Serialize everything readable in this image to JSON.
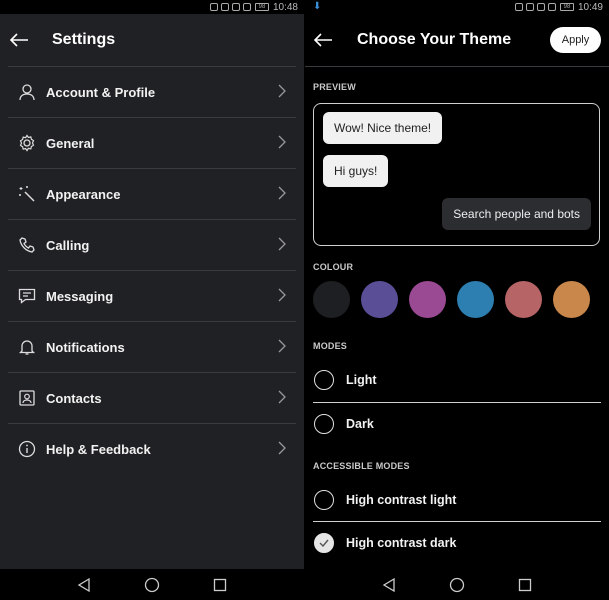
{
  "left": {
    "status_time": "10:48",
    "battery": "98",
    "title": "Settings",
    "items": [
      {
        "label": "Account & Profile",
        "icon": "person-icon"
      },
      {
        "label": "General",
        "icon": "gear-icon"
      },
      {
        "label": "Appearance",
        "icon": "magic-wand-icon"
      },
      {
        "label": "Calling",
        "icon": "phone-icon"
      },
      {
        "label": "Messaging",
        "icon": "chat-icon"
      },
      {
        "label": "Notifications",
        "icon": "bell-icon"
      },
      {
        "label": "Contacts",
        "icon": "contact-card-icon"
      },
      {
        "label": "Help & Feedback",
        "icon": "info-icon"
      }
    ]
  },
  "right": {
    "status_time": "10:49",
    "battery": "98",
    "title": "Choose Your Theme",
    "apply_label": "Apply",
    "preview_label": "PREVIEW",
    "preview_messages": [
      {
        "text": "Wow! Nice theme!",
        "side": "in"
      },
      {
        "text": "Hi guys!",
        "side": "in"
      },
      {
        "text": "Search people and bots",
        "side": "out"
      }
    ],
    "colour_label": "COLOUR",
    "swatches": [
      "#1e1f22",
      "#5a4e97",
      "#9a4a93",
      "#2c7fb0",
      "#b66465",
      "#c9874b"
    ],
    "modes_label": "MODES",
    "modes": [
      {
        "label": "Light",
        "checked": false
      },
      {
        "label": "Dark",
        "checked": false
      }
    ],
    "accessible_label": "ACCESSIBLE MODES",
    "accessible_modes": [
      {
        "label": "High contrast light",
        "checked": false
      },
      {
        "label": "High contrast dark",
        "checked": true
      }
    ]
  }
}
